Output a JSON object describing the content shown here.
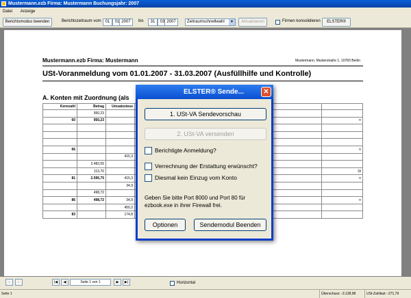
{
  "window": {
    "title": "Mustermann.ezb   Firma: Mustermann   Buchungsjahr: 2007"
  },
  "menu": {
    "items": [
      "Datei",
      "Anzeige"
    ]
  },
  "toolbar": {
    "report_mode_end": "Berichtsmodus beenden",
    "period_from_label": "Berichtszeitraum vom",
    "from_day": "01",
    "from_month": "01",
    "from_year": "2007",
    "to_label": "bis",
    "to_day": "31",
    "to_month": "03",
    "to_year": "2007",
    "quick_select": "Zeitraumschnellwahl",
    "refresh": "Aktualisieren",
    "consolidate_label": "Firmen konsolidieren",
    "elster": "ELSTER®"
  },
  "document": {
    "header_left": "Mustermann.ezb   Firma: Mustermann",
    "header_right": "Mustermann, Musterstraße 1, 10783 Berlin",
    "title": "USt-Voranmeldung vom 01.01.2007 - 31.03.2007    (Ausfüllhilfe und Kontrolle)",
    "section": "A. Konten mit Zuordnung (als",
    "columns": [
      "Kennzahl",
      "Betrag",
      "Umsatzsteue",
      "",
      "",
      ""
    ],
    "rows": [
      [
        "",
        "950,23",
        "",
        "",
        "",
        ""
      ],
      [
        "60",
        "950,23",
        "",
        "",
        "",
        "n"
      ],
      [
        "",
        "",
        "",
        "",
        "",
        ""
      ],
      [
        "",
        "",
        "",
        "",
        "",
        ""
      ],
      [
        "",
        "",
        "",
        "",
        "",
        ""
      ],
      [
        "66",
        "",
        "",
        "",
        "",
        "n"
      ],
      [
        "",
        "",
        "415,3",
        "",
        "",
        ""
      ],
      [
        "",
        "2.482,05",
        "",
        "",
        "",
        ""
      ],
      [
        "",
        "113,70",
        "",
        "",
        "",
        "St"
      ],
      [
        "81",
        "2.595,75",
        "415,3",
        "",
        "",
        "n"
      ],
      [
        "",
        "",
        "34,9",
        "",
        "",
        ""
      ],
      [
        "",
        "498,72",
        "",
        "",
        "",
        ""
      ],
      [
        "86",
        "498,72",
        "34,9",
        "",
        "",
        "n"
      ],
      [
        "",
        "",
        "450,2",
        "",
        "",
        ""
      ],
      [
        "83",
        "",
        "174,8",
        "",
        "",
        ""
      ]
    ]
  },
  "nav": {
    "page_text": "Seite 1 von 1",
    "horizontal": "Horizontal"
  },
  "status": {
    "page": "Seite 1",
    "surplus": "Überschuss: -3.138,98",
    "payload": "USt-Zahllast: -271,79"
  },
  "dialog": {
    "title": "ELSTER® Sende...",
    "preview_button": "1. USt-VA Sendevorschau",
    "send_button": "2. USt-VA versenden",
    "corrected": "Berichtigte Anmeldung?",
    "offset": "Verrechnung der Erstattung erwünscht?",
    "no_debit": "Diesmal kein Einzug vom Konto",
    "info": "Geben Sie bitte Port 8000 und Port 80 für ezbook.exe in ihrer Firewall frei.",
    "options_button": "Optionen",
    "end_button": "Sendemodul Beenden"
  }
}
